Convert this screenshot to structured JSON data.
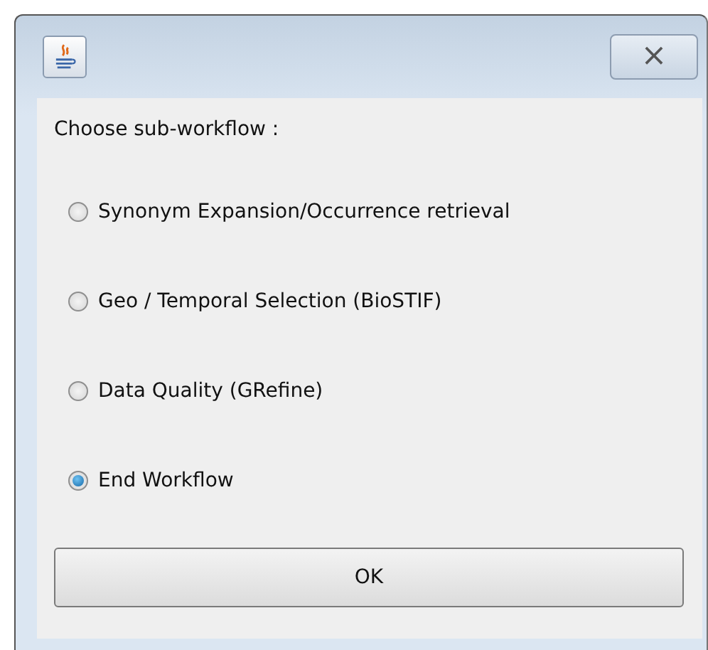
{
  "window": {
    "close_label": "×"
  },
  "prompt": "Choose sub-workflow :",
  "options": [
    {
      "label": "Synonym Expansion/Occurrence retrieval",
      "selected": false
    },
    {
      "label": "Geo / Temporal Selection (BioSTIF)",
      "selected": false
    },
    {
      "label": "Data Quality (GRefine)",
      "selected": false
    },
    {
      "label": "End Workflow",
      "selected": true
    }
  ],
  "buttons": [
    "OK"
  ]
}
